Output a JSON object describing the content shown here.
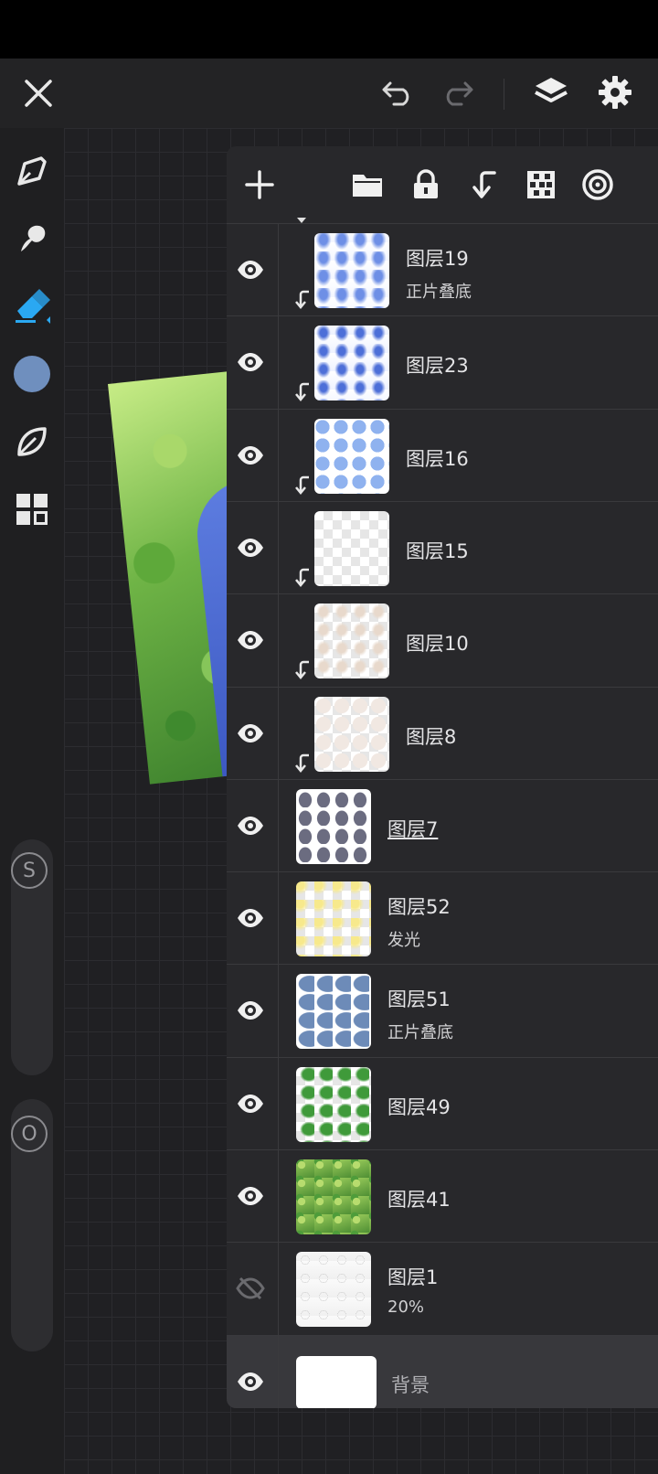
{
  "colors": {
    "accent": "#2aa8f2",
    "current_color": "#6f8fbe"
  },
  "top_bar": {
    "close_icon": "close-icon",
    "undo_icon": "undo-icon",
    "redo_icon": "redo-icon",
    "layers_icon": "layers-icon",
    "settings_icon": "gear-icon"
  },
  "left_toolbar": {
    "tools": [
      "pen-icon",
      "smudge-icon",
      "eraser-icon",
      "color-swatch",
      "leaf-icon",
      "grid-icon"
    ],
    "size_slider_label": "S",
    "opacity_slider_label": "O"
  },
  "layers_toolbar": [
    "add-icon",
    "folder-icon",
    "lock-icon",
    "clip-icon",
    "checker-icon",
    "target-icon"
  ],
  "layers": [
    {
      "name": "图层19",
      "mode": "正片叠底",
      "visible": true,
      "clipped": true
    },
    {
      "name": "图层23",
      "mode": "",
      "visible": true,
      "clipped": true
    },
    {
      "name": "图层16",
      "mode": "",
      "visible": true,
      "clipped": true
    },
    {
      "name": "图层15",
      "mode": "",
      "visible": true,
      "clipped": true
    },
    {
      "name": "图层10",
      "mode": "",
      "visible": true,
      "clipped": true
    },
    {
      "name": "图层8",
      "mode": "",
      "visible": true,
      "clipped": true
    },
    {
      "name": "图层7",
      "mode": "",
      "visible": true,
      "clipped": false
    },
    {
      "name": "图层52",
      "mode": "发光",
      "visible": true,
      "clipped": false
    },
    {
      "name": "图层51",
      "mode": "正片叠底",
      "visible": true,
      "clipped": false
    },
    {
      "name": "图层49",
      "mode": "",
      "visible": true,
      "clipped": false
    },
    {
      "name": "图层41",
      "mode": "",
      "visible": true,
      "clipped": false
    },
    {
      "name": "图层1",
      "mode": "20%",
      "visible": false,
      "clipped": false
    },
    {
      "name": "背景",
      "mode": "",
      "visible": true,
      "clipped": false
    }
  ]
}
